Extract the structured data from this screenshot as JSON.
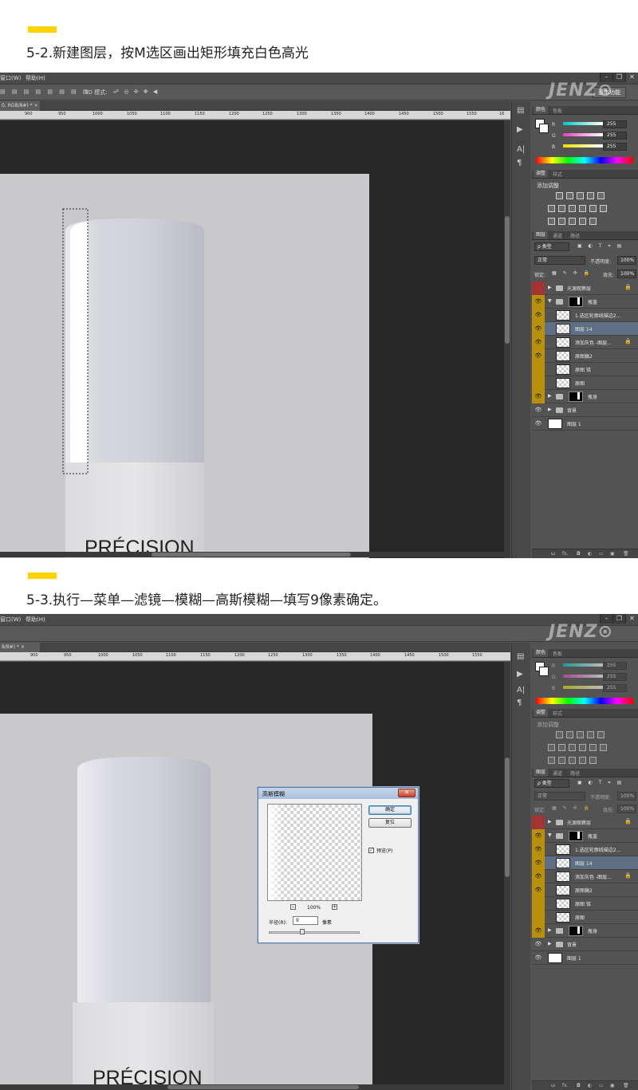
{
  "step1": {
    "title": "5-2.新建图层，按M选区画出矩形填充白色高光"
  },
  "step2": {
    "title": "5-3.执行—菜单—滤镜—模糊—高斯模糊—填写9像素确定。"
  },
  "watermark": "JENZ",
  "menu": {
    "window": "窗口(W)",
    "help": "帮助(H)"
  },
  "options": {
    "mode3d": "3D 模式:",
    "workspace": "基本功能"
  },
  "doc_tab_1": "0, RGB/8#) *",
  "doc_tab_2": "8/8#) *",
  "ruler_ticks": [
    "900",
    "950",
    "1000",
    "1050",
    "1100",
    "1150",
    "1200",
    "1250",
    "1300",
    "1350",
    "1400",
    "1450",
    "1500",
    "1550",
    "16"
  ],
  "bottle_text": "PRÉCISION",
  "color_panel": {
    "tabs": [
      "颜色",
      "色板"
    ],
    "channels": [
      {
        "label": "R",
        "value": "255",
        "color": "#00c8c8"
      },
      {
        "label": "G",
        "value": "255",
        "color": "#e040c0"
      },
      {
        "label": "B",
        "value": "255",
        "color": "#e8e000"
      }
    ]
  },
  "adjust_panel": {
    "tabs": [
      "调整",
      "样式"
    ],
    "add_label": "添加调整"
  },
  "layers_panel": {
    "tabs": [
      "图层",
      "通道",
      "路径"
    ],
    "filter": "ρ 类型",
    "blend_mode": "正常",
    "opacity_label": "不透明度:",
    "opacity_value": "100%",
    "lock_label": "锁定:",
    "fill_label": "填充:",
    "fill_value": "100%",
    "layers": [
      {
        "name": "光源观察层",
        "kind": "group",
        "mark": "red",
        "lock": true
      },
      {
        "name": "瓶盖",
        "kind": "group-open",
        "mark": "on",
        "mask": true
      },
      {
        "name": "1.选区轮廓线描边2...",
        "kind": "layer",
        "mark": "on"
      },
      {
        "name": "图层 14",
        "kind": "layer",
        "mark": "on",
        "selected": true
      },
      {
        "name": "添加灰色 -图层...",
        "kind": "layer",
        "mark": "on",
        "lock": true
      },
      {
        "name": "原图稿2",
        "kind": "layer",
        "mark": "on"
      },
      {
        "name": "原图 铭",
        "kind": "layer",
        "mark": "on"
      },
      {
        "name": "原图",
        "kind": "layer",
        "mark": "on"
      },
      {
        "name": "瓶身",
        "kind": "group",
        "mark": "on",
        "mask": true
      },
      {
        "name": "背景",
        "kind": "group",
        "mark": "plain"
      },
      {
        "name": "图层 1",
        "kind": "white",
        "mark": "plain"
      }
    ],
    "footer": [
      "ω",
      "fx.",
      "◘",
      "◐",
      "▭",
      "▣",
      "🗑"
    ]
  },
  "gaussian_dialog": {
    "title": "高斯模糊",
    "ok": "确定",
    "reset": "复位",
    "preview": "预览(P)",
    "zoom": "100%",
    "radius_label": "半径(R):",
    "radius_value": "9",
    "unit": "像素"
  }
}
